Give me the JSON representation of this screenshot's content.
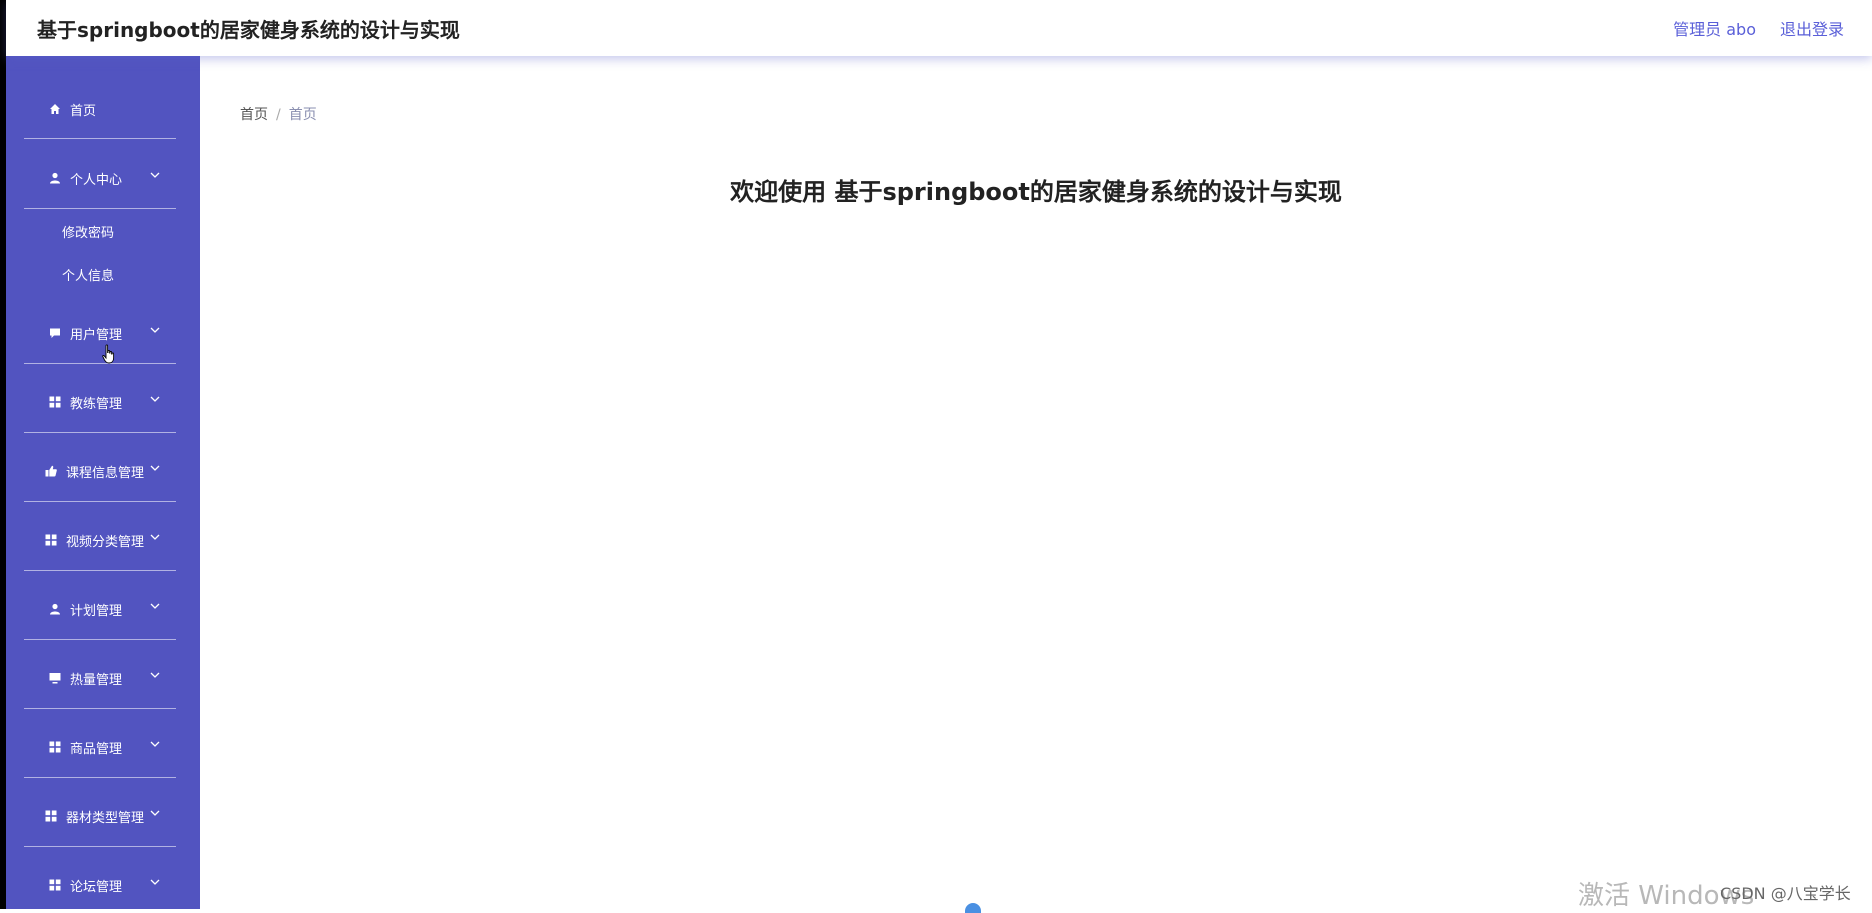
{
  "header": {
    "title": "基于springboot的居家健身系统的设计与实现",
    "user_label": "管理员 abo",
    "logout_label": "退出登录"
  },
  "sidebar": {
    "items": [
      {
        "label": "首页",
        "icon": "home-icon"
      },
      {
        "label": "个人中心",
        "icon": "user-icon",
        "expanded": true,
        "children": [
          "修改密码",
          "个人信息"
        ]
      },
      {
        "label": "用户管理",
        "icon": "chat-icon"
      },
      {
        "label": "教练管理",
        "icon": "grid-icon"
      },
      {
        "label": "课程信息管理",
        "icon": "thumbs-up-icon"
      },
      {
        "label": "视频分类管理",
        "icon": "grid-icon"
      },
      {
        "label": "计划管理",
        "icon": "user-icon"
      },
      {
        "label": "热量管理",
        "icon": "monitor-icon"
      },
      {
        "label": "商品管理",
        "icon": "grid-icon"
      },
      {
        "label": "器材类型管理",
        "icon": "grid-icon"
      },
      {
        "label": "论坛管理",
        "icon": "grid-icon"
      }
    ]
  },
  "breadcrumb": [
    "首页",
    "首页"
  ],
  "main": {
    "welcome": "欢迎使用 基于springboot的居家健身系统的设计与实现"
  },
  "overlay": {
    "watermark": "激活 Windows",
    "csdn": "CSDN @八宝学长"
  },
  "colors": {
    "sidebar_bg": "#5254c0",
    "accent": "#5a5fd8"
  }
}
